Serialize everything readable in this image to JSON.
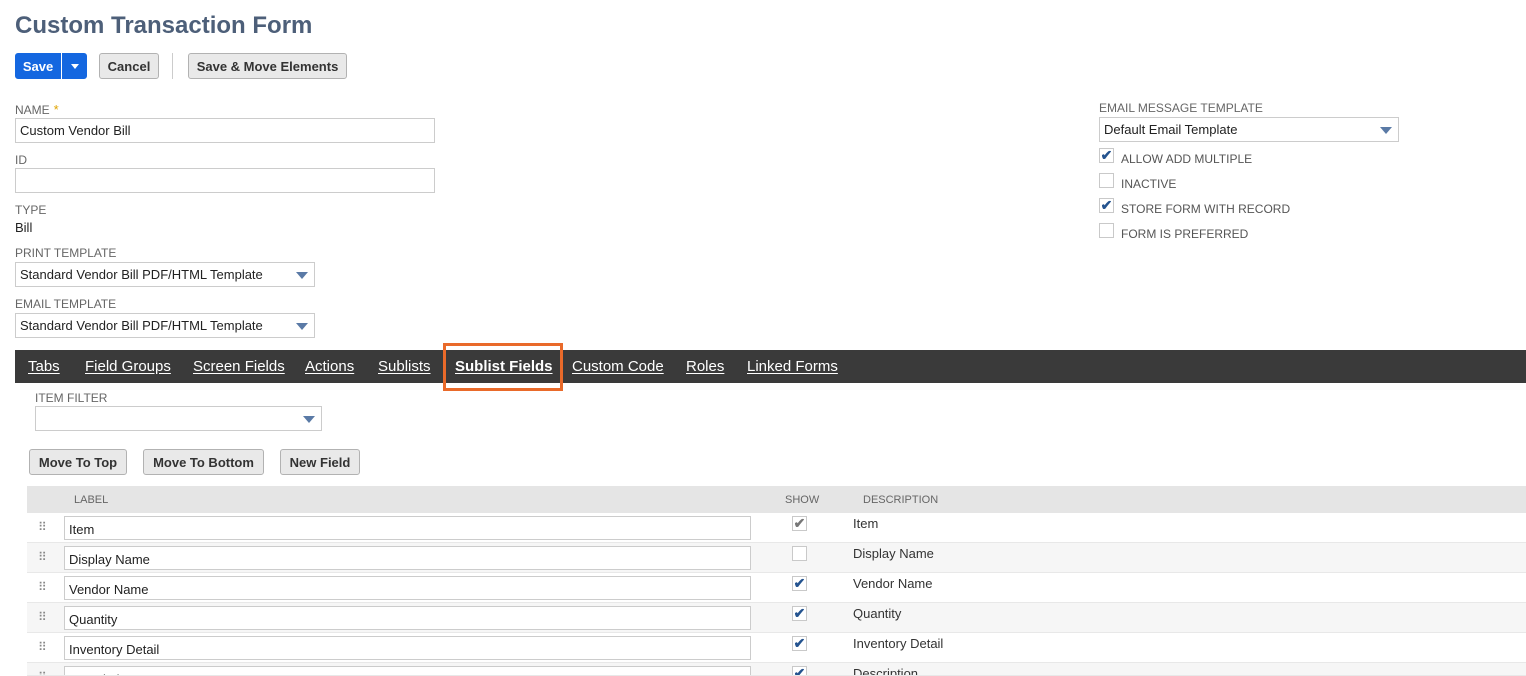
{
  "page": {
    "title": "Custom Transaction Form"
  },
  "toolbar": {
    "save_label": "Save",
    "cancel_label": "Cancel",
    "save_move_label": "Save & Move Elements"
  },
  "form": {
    "name_label": "NAME",
    "name_required_mark": "*",
    "name_value": "Custom Vendor Bill",
    "id_label": "ID",
    "id_value": "",
    "type_label": "TYPE",
    "type_value": "Bill",
    "print_template_label": "PRINT TEMPLATE",
    "print_template_value": "Standard Vendor Bill PDF/HTML Template",
    "email_template_label": "EMAIL TEMPLATE",
    "email_template_value": "Standard Vendor Bill PDF/HTML Template",
    "email_message_template_label": "EMAIL MESSAGE TEMPLATE",
    "email_message_template_value": "Default Email Template",
    "options": [
      {
        "label": "ALLOW ADD MULTIPLE",
        "checked": true,
        "mark": "✔"
      },
      {
        "label": "INACTIVE",
        "checked": false,
        "mark": ""
      },
      {
        "label": "STORE FORM WITH RECORD",
        "checked": true,
        "mark": "✔"
      },
      {
        "label": "FORM IS PREFERRED",
        "checked": false,
        "mark": ""
      }
    ]
  },
  "tabs": [
    {
      "label": "Tabs",
      "active": false
    },
    {
      "label": "Field Groups",
      "active": false
    },
    {
      "label": "Screen Fields",
      "active": false
    },
    {
      "label": "Actions",
      "active": false
    },
    {
      "label": "Sublists",
      "active": false
    },
    {
      "label": "Sublist Fields",
      "active": true
    },
    {
      "label": "Custom Code",
      "active": false
    },
    {
      "label": "Roles",
      "active": false
    },
    {
      "label": "Linked Forms",
      "active": false
    }
  ],
  "sublist": {
    "item_filter_label": "ITEM FILTER",
    "item_filter_value": "",
    "move_top_label": "Move To Top",
    "move_bottom_label": "Move To Bottom",
    "new_field_label": "New Field",
    "columns": {
      "label": "LABEL",
      "show": "SHOW",
      "description": "DESCRIPTION"
    },
    "drag_glyph": "⠿",
    "rows": [
      {
        "label": "Item",
        "show": true,
        "mark": "✔",
        "description": "Item"
      },
      {
        "label": "Display Name",
        "show": false,
        "mark": "",
        "description": "Display Name"
      },
      {
        "label": "Vendor Name",
        "show": true,
        "mark": "✔",
        "description": "Vendor Name"
      },
      {
        "label": "Quantity",
        "show": true,
        "mark": "✔",
        "description": "Quantity"
      },
      {
        "label": "Inventory Detail",
        "show": true,
        "mark": "✔",
        "description": "Inventory Detail"
      },
      {
        "label": "Description",
        "show": true,
        "mark": "✔",
        "description": "Description"
      }
    ]
  },
  "colors": {
    "accent": "#1467e0",
    "tab_bar": "#3a3a3a",
    "highlight": "#e96a2a",
    "title": "#4d5f79"
  }
}
